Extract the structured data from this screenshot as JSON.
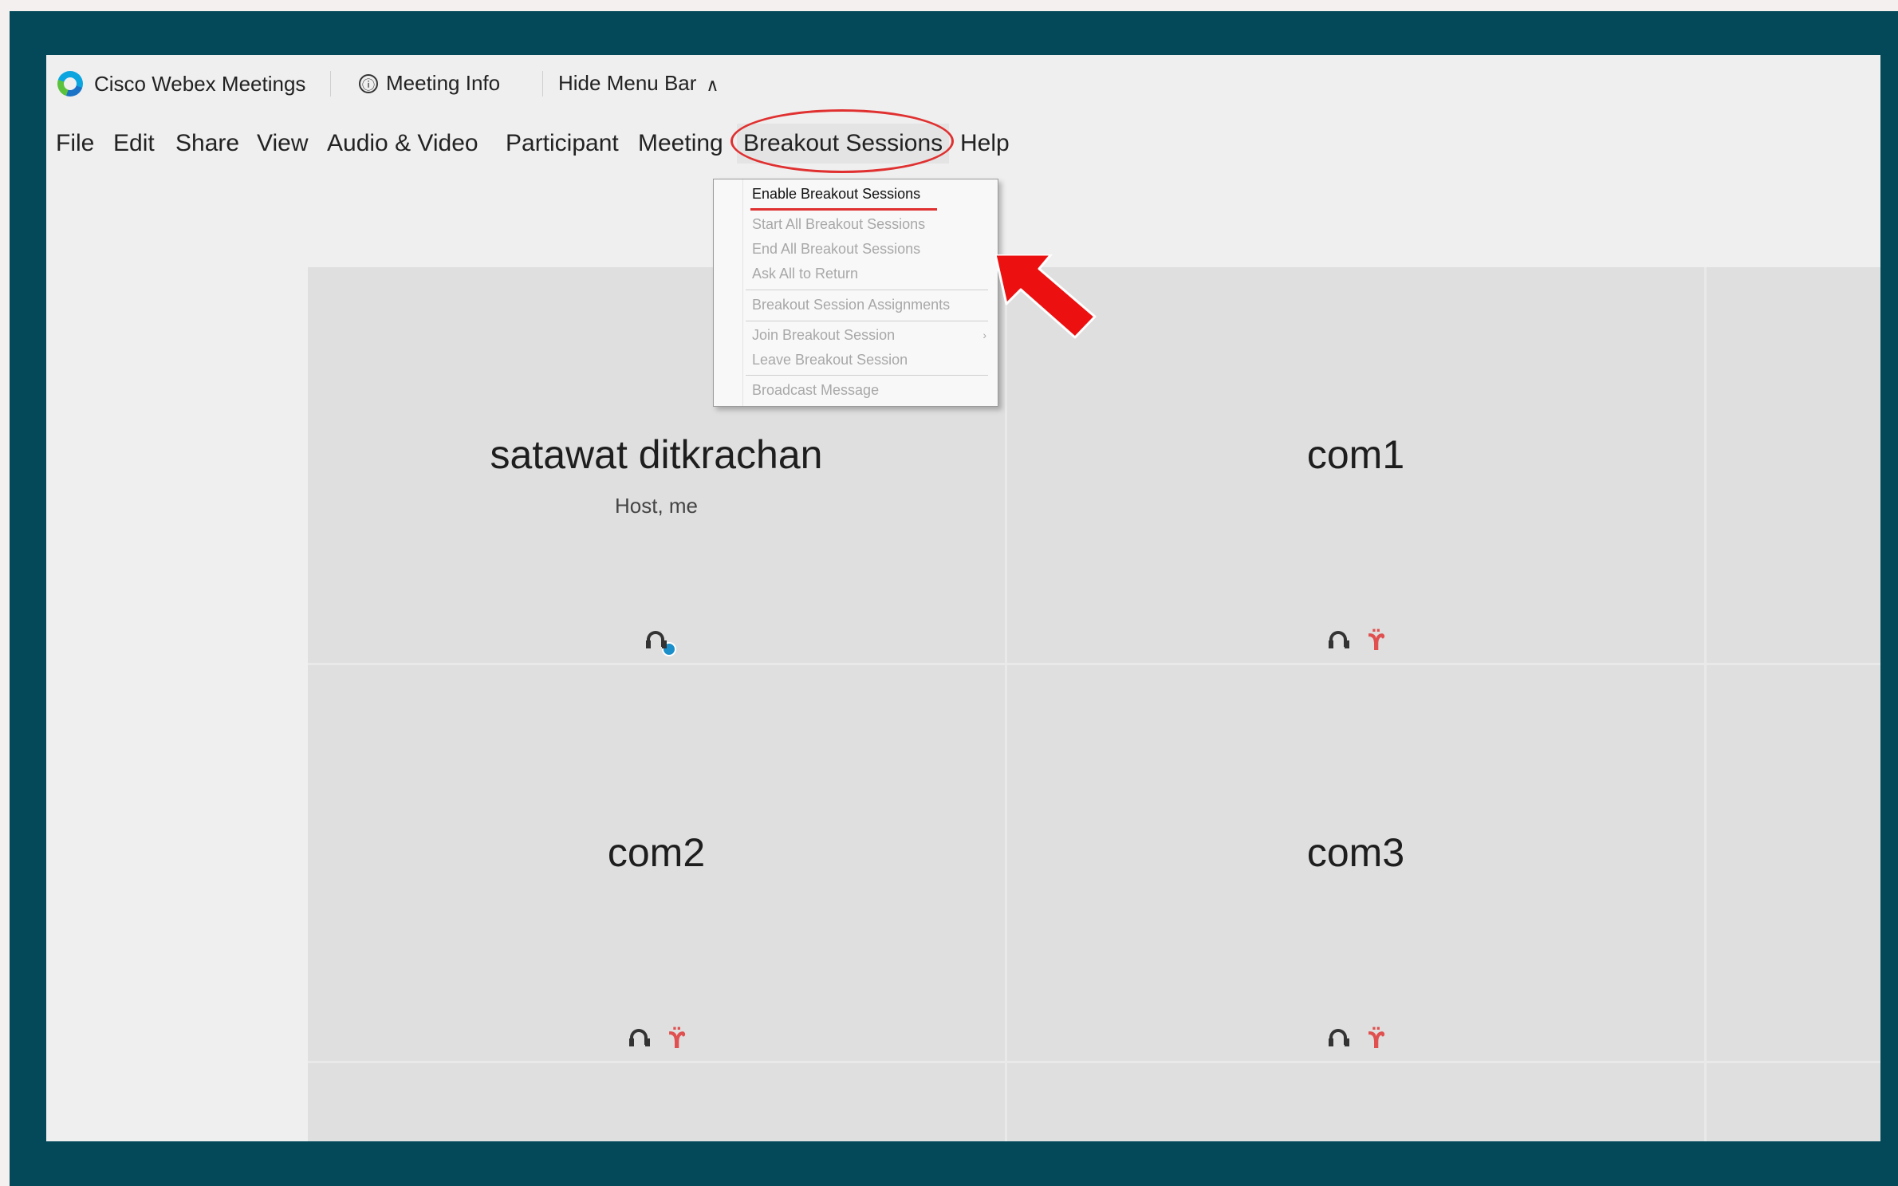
{
  "titlebar": {
    "app_name": "Cisco Webex Meetings",
    "meeting_info": "Meeting Info",
    "hide_menu_bar": "Hide Menu Bar"
  },
  "menubar": {
    "items": [
      "File",
      "Edit",
      "Share",
      "View",
      "Audio & Video",
      "Participant",
      "Meeting",
      "Breakout Sessions",
      "Help"
    ]
  },
  "breakout_menu": {
    "items": [
      {
        "label": "Enable Breakout Sessions",
        "enabled": true
      },
      {
        "label": "Start All Breakout Sessions",
        "enabled": false
      },
      {
        "label": "End All Breakout Sessions",
        "enabled": false
      },
      {
        "label": "Ask All to Return",
        "enabled": false
      },
      {
        "label": "Breakout Session Assignments",
        "enabled": false
      },
      {
        "label": "Join Breakout Session",
        "enabled": false
      },
      {
        "label": "Leave Breakout Session",
        "enabled": false
      },
      {
        "label": "Broadcast Message",
        "enabled": false
      }
    ],
    "submenu_glyph": "›"
  },
  "participants": [
    {
      "name": "satawat ditkrachan",
      "subtitle": "Host, me",
      "audio": "connected"
    },
    {
      "name": "com1",
      "subtitle": "",
      "audio": "muted"
    },
    {
      "name": "com2",
      "subtitle": "",
      "audio": "muted"
    },
    {
      "name": "com3",
      "subtitle": "",
      "audio": "muted"
    }
  ],
  "icons": {
    "info": "ⓘ",
    "chevron_up": "∧",
    "mic_muted": "ϔ"
  },
  "colors": {
    "frame": "#04495a",
    "highlight": "#e03030",
    "muted": "#e05050",
    "connected": "#1b8fc9"
  }
}
